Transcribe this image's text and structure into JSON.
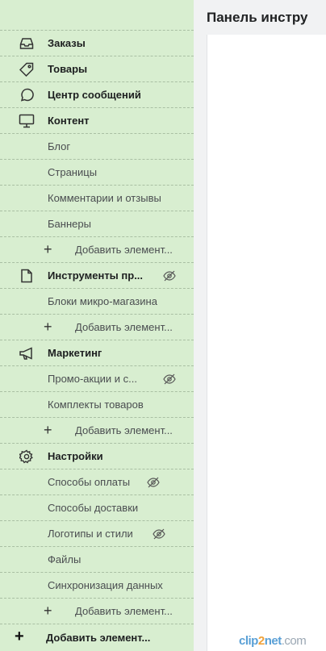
{
  "sidebar": {
    "items": [
      {
        "label": "Заказы",
        "icon": "inbox-icon"
      },
      {
        "label": "Товары",
        "icon": "tag-icon"
      },
      {
        "label": "Центр сообщений",
        "icon": "chat-icon"
      },
      {
        "label": "Контент",
        "icon": "monitor-icon"
      }
    ],
    "content_sub": [
      "Блог",
      "Страницы",
      "Комментарии и отзывы",
      "Баннеры"
    ],
    "add_element": "Добавить элемент...",
    "tools": {
      "label": "Инструменты пр...",
      "icon": "file-icon"
    },
    "tools_sub": [
      "Блоки микро-магазина"
    ],
    "marketing": {
      "label": "Маркетинг",
      "icon": "megaphone-icon"
    },
    "marketing_sub": [
      "Промо-акции и с...",
      "Комплекты товаров"
    ],
    "settings": {
      "label": "Настройки",
      "icon": "gear-icon"
    },
    "settings_sub": [
      "Способы оплаты",
      "Способы доставки",
      "Логотипы и стили",
      "Файлы",
      "Синхронизация данных"
    ],
    "add_main": "Добавить элемент..."
  },
  "main": {
    "title": "Панель инстру"
  },
  "watermark": {
    "a": "clip",
    "b": "2",
    "c": "net",
    "d": ".com"
  },
  "colors": {
    "sidebar_bg": "#d8eed0",
    "divider": "#a9bfa3"
  }
}
